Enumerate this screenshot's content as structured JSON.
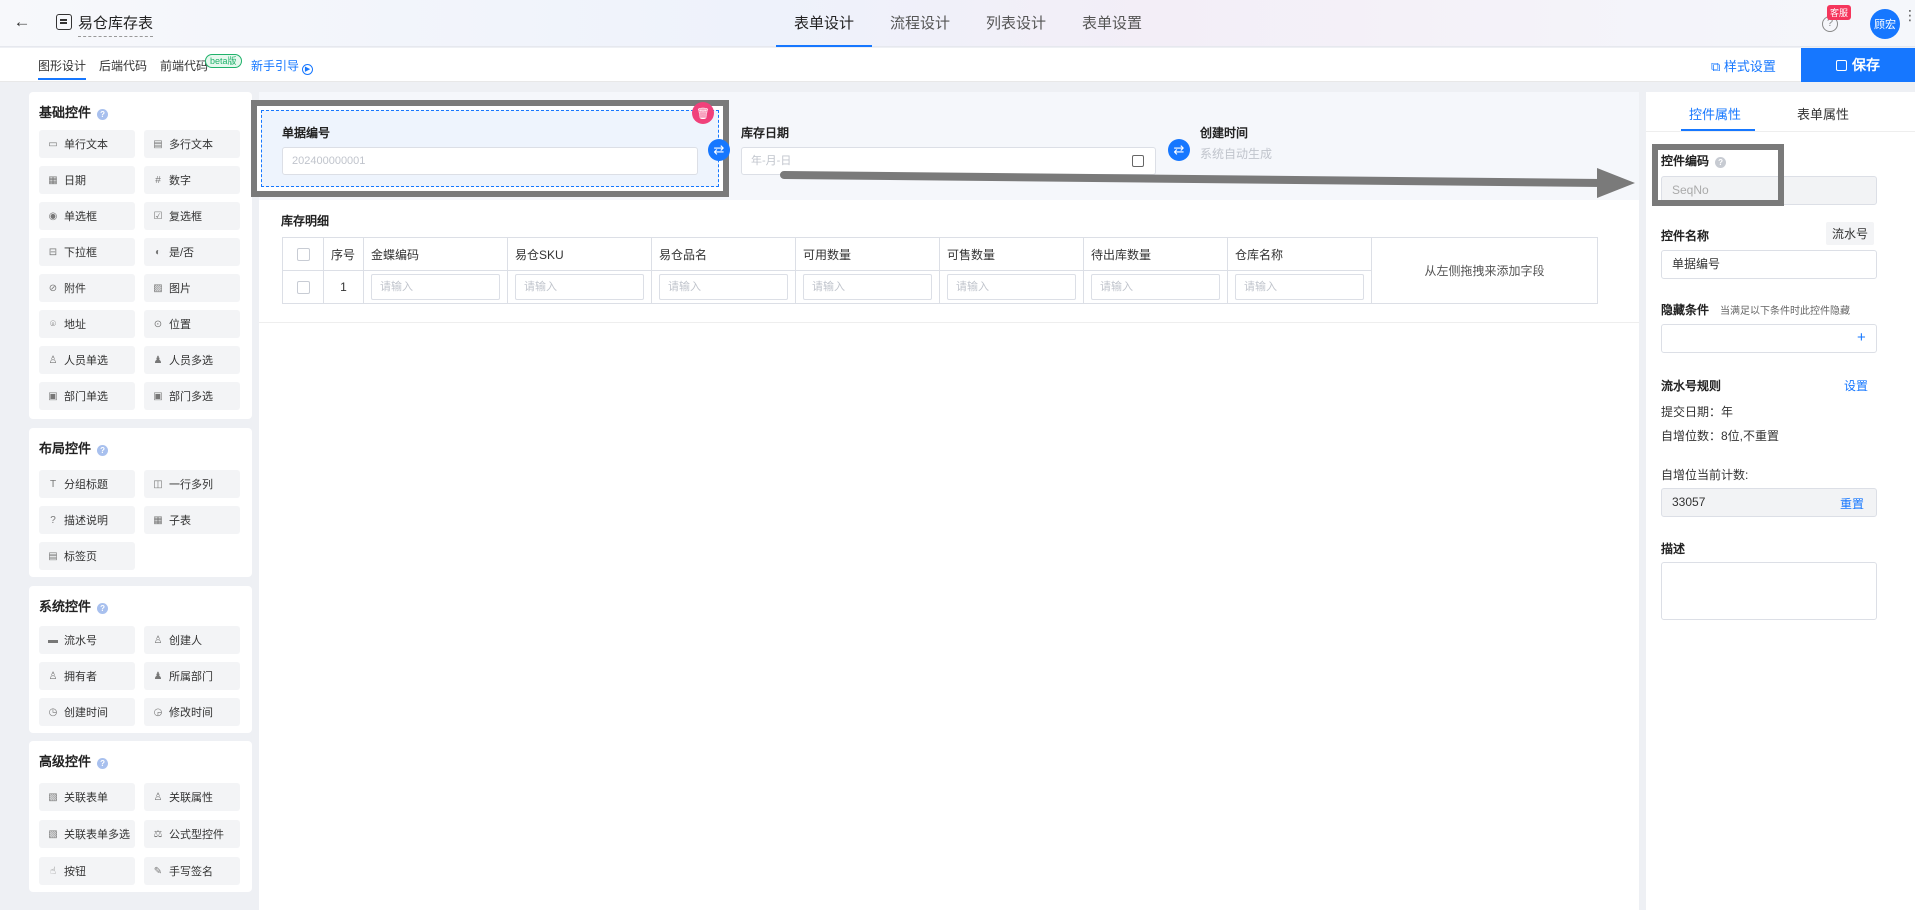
{
  "header": {
    "back_icon": "back-arrow-icon",
    "doc_icon": "form-icon",
    "title": "易仓库存表",
    "tabs": [
      "表单设计",
      "流程设计",
      "列表设计",
      "表单设置"
    ],
    "active_tab": "表单设计",
    "kefu_badge": "客服",
    "avatar_text": "顾宏",
    "accent": "#1677ff"
  },
  "toolbar": {
    "tabs": [
      "图形设计",
      "后端代码",
      "前端代码"
    ],
    "beta": "beta版",
    "guide": "新手引导",
    "style_settings": "样式设置",
    "save": "保存"
  },
  "left": {
    "basic": {
      "title": "基础控件",
      "items": [
        {
          "label": "单行文本",
          "icon": "single-line-text-icon"
        },
        {
          "label": "多行文本",
          "icon": "multi-line-text-icon"
        },
        {
          "label": "日期",
          "icon": "calendar-icon"
        },
        {
          "label": "数字",
          "icon": "number-icon"
        },
        {
          "label": "单选框",
          "icon": "radio-icon"
        },
        {
          "label": "复选框",
          "icon": "checkbox-icon"
        },
        {
          "label": "下拉框",
          "icon": "dropdown-icon"
        },
        {
          "label": "是/否",
          "icon": "toggle-icon"
        },
        {
          "label": "附件",
          "icon": "paperclip-icon"
        },
        {
          "label": "图片",
          "icon": "image-icon"
        },
        {
          "label": "地址",
          "icon": "map-pin-icon"
        },
        {
          "label": "位置",
          "icon": "location-icon"
        },
        {
          "label": "人员单选",
          "icon": "user-icon"
        },
        {
          "label": "人员多选",
          "icon": "users-icon"
        },
        {
          "label": "部门单选",
          "icon": "department-icon"
        },
        {
          "label": "部门多选",
          "icon": "departments-icon"
        }
      ]
    },
    "layout": {
      "title": "布局控件",
      "items": [
        {
          "label": "分组标题",
          "icon": "heading-icon"
        },
        {
          "label": "一行多列",
          "icon": "columns-icon"
        },
        {
          "label": "描述说明",
          "icon": "help-circle-icon"
        },
        {
          "label": "子表",
          "icon": "table-icon"
        },
        {
          "label": "标签页",
          "icon": "tabs-icon"
        }
      ]
    },
    "system": {
      "title": "系统控件",
      "items": [
        {
          "label": "流水号",
          "icon": "serial-number-icon"
        },
        {
          "label": "创建人",
          "icon": "user-icon"
        },
        {
          "label": "拥有者",
          "icon": "owner-icon"
        },
        {
          "label": "所属部门",
          "icon": "department-icon"
        },
        {
          "label": "创建时间",
          "icon": "clock-icon"
        },
        {
          "label": "修改时间",
          "icon": "clock-edit-icon"
        }
      ]
    },
    "advanced": {
      "title": "高级控件",
      "items": [
        {
          "label": "关联表单",
          "icon": "link-form-icon"
        },
        {
          "label": "关联属性",
          "icon": "link-user-icon"
        },
        {
          "label": "关联表单多选",
          "icon": "link-forms-icon"
        },
        {
          "label": "公式型控件",
          "icon": "formula-icon"
        },
        {
          "label": "按钮",
          "icon": "button-icon"
        },
        {
          "label": "手写签名",
          "icon": "pen-icon"
        }
      ]
    }
  },
  "canvas": {
    "fields": [
      {
        "label": "单据编号",
        "placeholder": "202400000001"
      },
      {
        "label": "库存日期",
        "placeholder": "年-月-日"
      },
      {
        "label": "创建时间",
        "placeholder": "系统自动生成"
      }
    ],
    "subtable": {
      "title": "库存明细",
      "columns": [
        "序号",
        "金蝶编码",
        "易仓SKU",
        "易仓品名",
        "可用数量",
        "可售数量",
        "待出库数量",
        "仓库名称"
      ],
      "row_index": "1",
      "input_placeholder": "请输入",
      "drop_hint": "从左侧拖拽来添加字段"
    }
  },
  "right": {
    "tabs": [
      "控件属性",
      "表单属性"
    ],
    "code_label": "控件编码",
    "code_value": "SeqNo",
    "name_label": "控件名称",
    "type_tag": "流水号",
    "name_value": "单据编号",
    "hide_label": "隐藏条件",
    "hide_hint": "当满足以下条件时此控件隐藏",
    "rule_label": "流水号规则",
    "rule_link": "设置",
    "rule_date": "提交日期：年",
    "rule_digits": "自增位数：8位,不重置",
    "counter_label": "自增位当前计数:",
    "counter_value": "33057",
    "reset": "重置",
    "desc_label": "描述"
  }
}
